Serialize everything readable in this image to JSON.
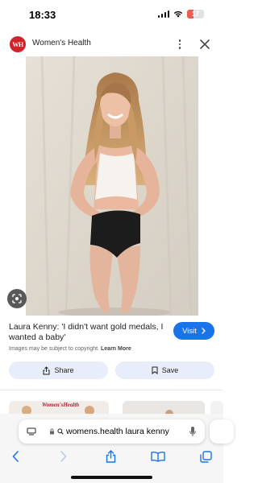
{
  "status_bar": {
    "time": "18:33",
    "battery": "17"
  },
  "source": {
    "name": "Women's Health",
    "logo_text": "WH"
  },
  "result": {
    "title": "Laura Kenny: 'I didn't want gold medals, I wanted a baby'",
    "visit_label": "Visit",
    "copyright_text": "Images may be subject to copyright.",
    "learn_more": "Learn More"
  },
  "actions": {
    "share_label": "Share",
    "save_label": "Save"
  },
  "related": {
    "thumb_logo": "Women'sHealth"
  },
  "browser": {
    "url_text": "womens.health laura kenny"
  },
  "colors": {
    "accent": "#1a73e8",
    "brand": "#d3232a",
    "action_bg": "#e8eef9"
  },
  "icons": {
    "close": "close-icon",
    "more": "more-vert-icon",
    "lens": "lens-search-icon",
    "share": "share-icon",
    "save": "bookmark-icon",
    "back": "chevron-left-icon",
    "forward": "chevron-right-icon",
    "book": "book-icon",
    "tabs": "tabs-icon",
    "mic": "mic-icon"
  }
}
